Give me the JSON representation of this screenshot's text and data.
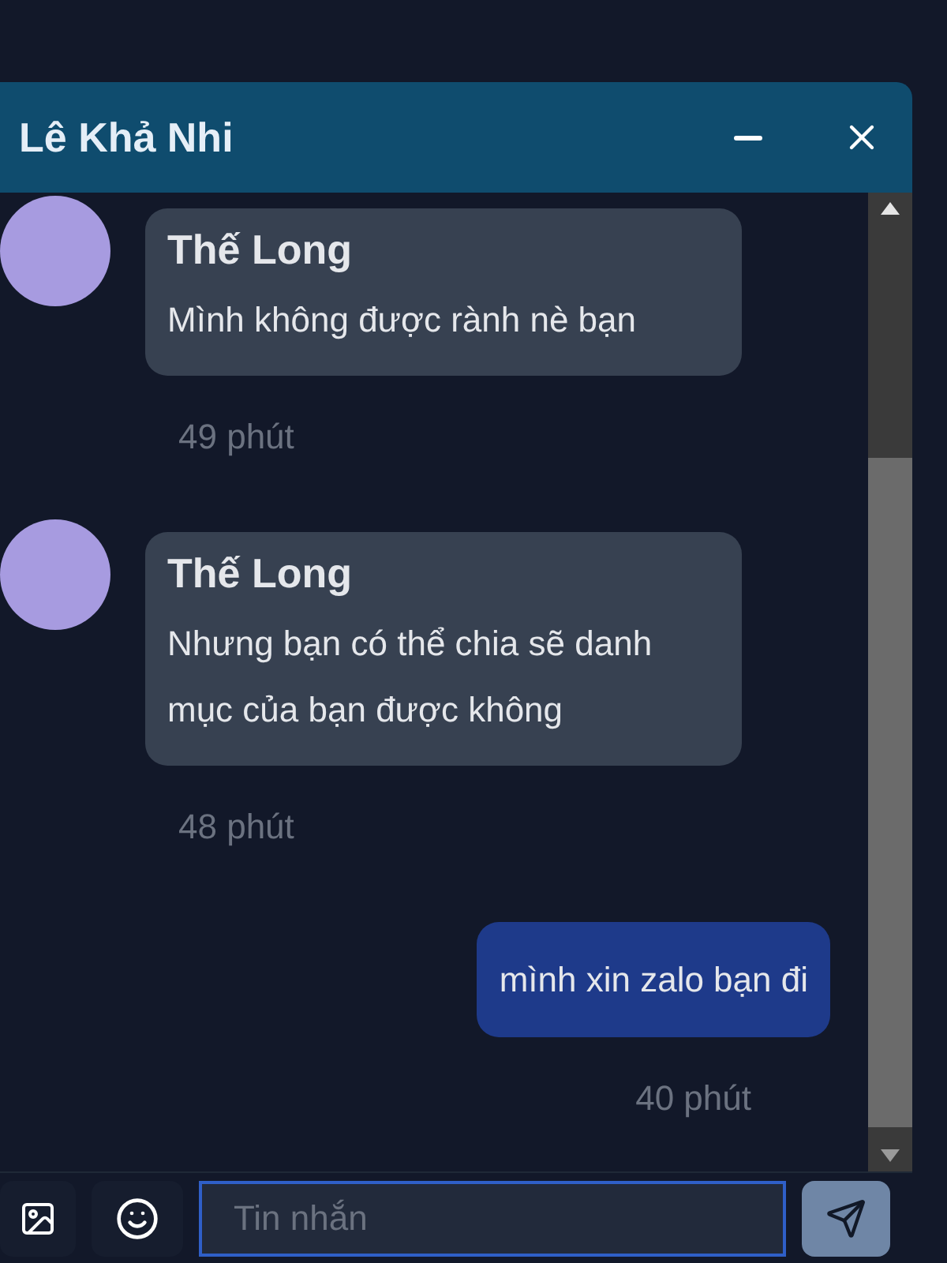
{
  "chat": {
    "title": "Lê Khả Nhi"
  },
  "messages": [
    {
      "kind": "received",
      "sender": "Thế Long",
      "text": "Mình không được rành nè bạn",
      "time": "49 phút"
    },
    {
      "kind": "received",
      "sender": "Thế Long",
      "text": "Nhưng bạn có thể chia sẽ danh mục của bạn được không",
      "time": "48 phút"
    },
    {
      "kind": "sent",
      "text": "mình xin zalo bạn đi",
      "time": "40 phút"
    }
  ],
  "composer": {
    "placeholder": "Tin nhắn"
  }
}
